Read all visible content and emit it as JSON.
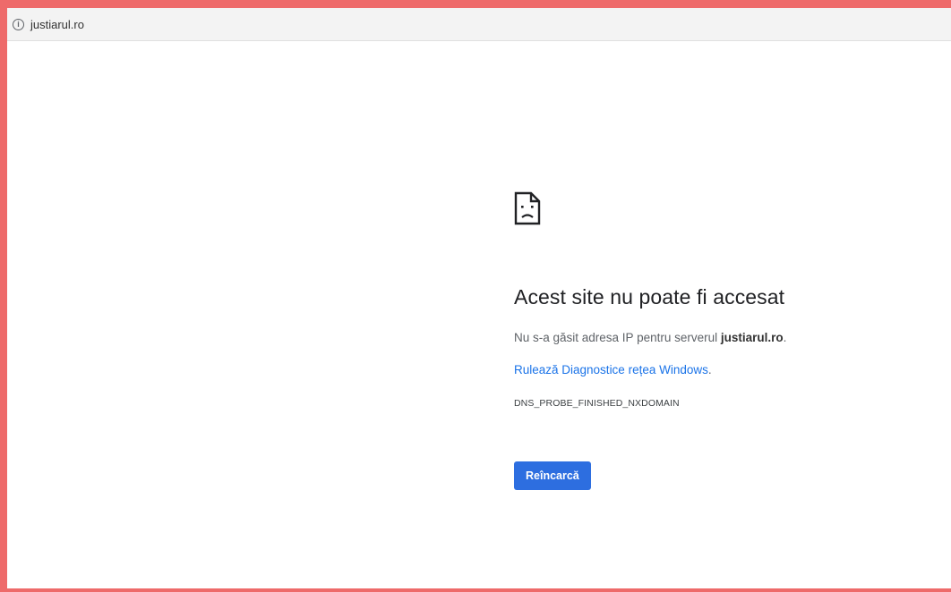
{
  "address_bar": {
    "info_icon": "info-icon",
    "url": "justiarul.ro"
  },
  "error_page": {
    "icon": "sad-page-icon",
    "title": "Acest site nu poate fi accesat",
    "message_prefix": "Nu s-a găsit adresa IP pentru serverul ",
    "message_host": "justiarul.ro",
    "message_suffix": ".",
    "diagnostics_link": "Rulează Diagnostice rețea Windows",
    "diagnostics_suffix": ".",
    "error_code": "DNS_PROBE_FINISHED_NXDOMAIN",
    "reload_label": "Reîncarcă"
  },
  "colors": {
    "frame_border": "#ee6a6a",
    "link": "#1a73e8",
    "button": "#2d6ee0"
  }
}
